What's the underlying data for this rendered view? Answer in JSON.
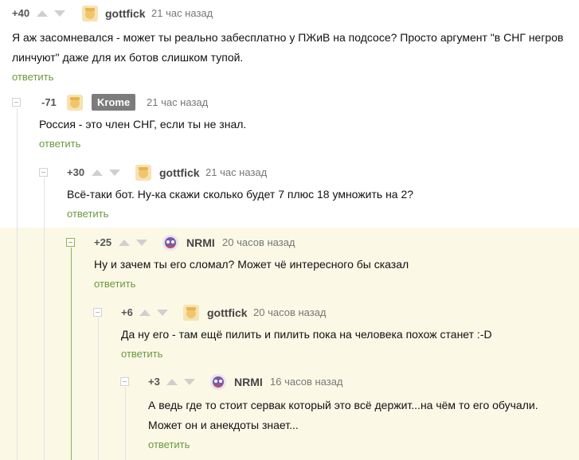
{
  "reply_label": "ответить",
  "comments": [
    {
      "rating": "+40",
      "author": "gottfick",
      "time": "21 час назад",
      "text": "Я аж засомневался - может ты реально забесплатно у ПЖиВ на подсосе? Просто аргумент \"в СНГ негров линчуют\" даже для их ботов слишком тупой."
    },
    {
      "rating": "-71",
      "author": "Krome",
      "time": "21 час назад",
      "text": "Россия - это член СНГ, если  ты не знал."
    },
    {
      "rating": "+30",
      "author": "gottfick",
      "time": "21 час назад",
      "text": "Всё-таки бот. Ну-ка скажи сколько будет 7 плюс 18 умножить на 2?"
    },
    {
      "rating": "+25",
      "author": "NRMI",
      "time": "20 часов назад",
      "text": "Ну и зачем ты его сломал? Может чё интересного бы сказал"
    },
    {
      "rating": "+6",
      "author": "gottfick",
      "time": "20 часов назад",
      "text": "Да ну его - там ещё пилить и пилить пока на человека похож станет :-D"
    },
    {
      "rating": "+3",
      "author": "NRMI",
      "time": "16 часов назад",
      "text": "А ведь где то стоит сервак который это всё держит...на чём то его обучали. Может он и анекдоты знает..."
    }
  ],
  "colors": {
    "highlight_bg": "#fbf8e6",
    "reply_link": "#6a9a3e",
    "thread_line_active": "#8ab65a",
    "thread_line": "#e3e3e3",
    "badge_bg": "#7c7c7c"
  }
}
